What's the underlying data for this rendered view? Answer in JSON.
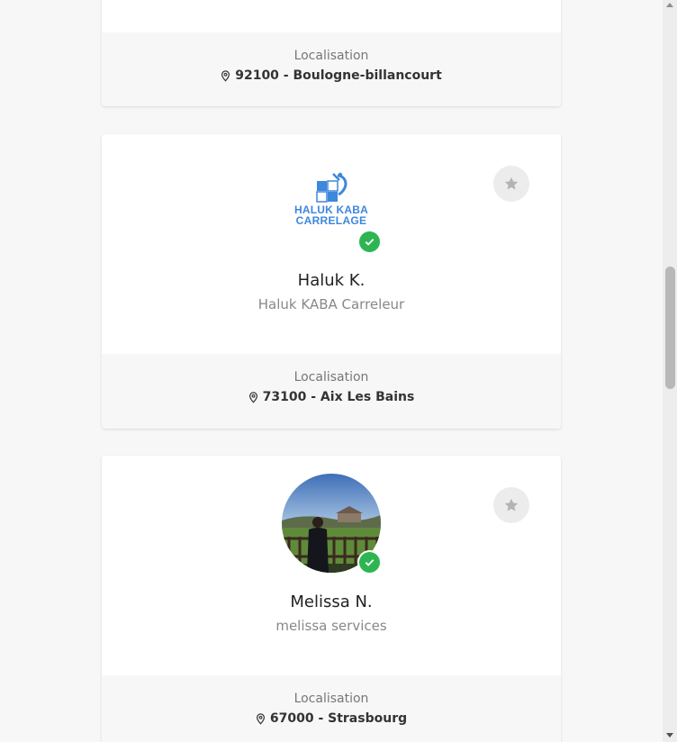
{
  "cards": [
    {
      "location_label": "Localisation",
      "location": "92100 - Boulogne-billancourt"
    },
    {
      "name": "Haluk K.",
      "company": "Haluk KABA Carreleur",
      "logo_text_line1": "HALUK KABA",
      "logo_text_line2": "CARRELAGE",
      "location_label": "Localisation",
      "location": "73100 - Aix Les Bains",
      "verified": true
    },
    {
      "name": "Melissa N.",
      "company": "melissa services",
      "location_label": "Localisation",
      "location": "67000 - Strasbourg",
      "verified": true
    }
  ],
  "icons": {
    "favorite": "star-icon",
    "verified": "check-icon",
    "location": "map-pin-icon"
  },
  "colors": {
    "verified": "#2db552",
    "logo_blue": "#3d87dc",
    "favorite_bg": "#ececec",
    "footer_bg": "#f7f7f7"
  }
}
